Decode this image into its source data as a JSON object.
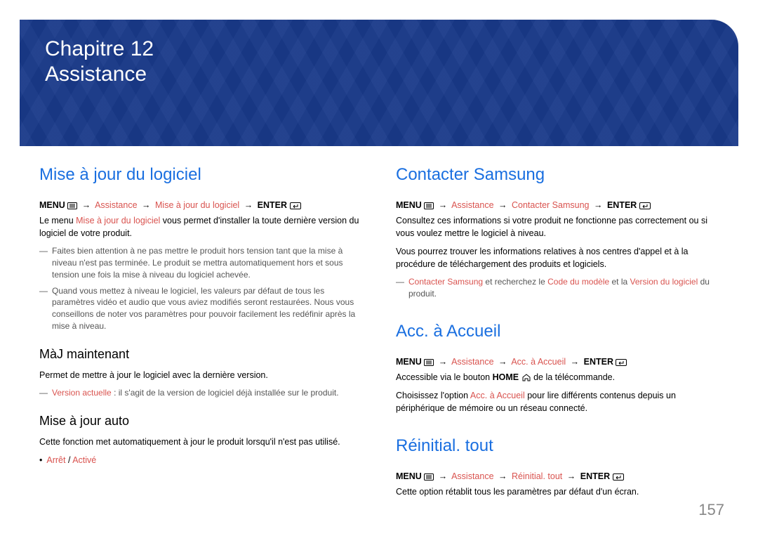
{
  "banner": {
    "line1": "Chapitre 12",
    "line2": "Assistance"
  },
  "pageNumber": "157",
  "menuLabel": "MENU",
  "enterLabel": "ENTER",
  "arrow": "→",
  "nav": {
    "assistance": "Assistance"
  },
  "softwareUpdate": {
    "title": "Mise à jour du logiciel",
    "navItem": "Mise à jour du logiciel",
    "intro_pre": "Le menu ",
    "intro_hl": "Mise à jour du logiciel",
    "intro_post": " vous permet d'installer la toute dernière version du logiciel de votre produit.",
    "note1": "Faites bien attention à ne pas mettre le produit hors tension tant que la mise à niveau n'est pas terminée. Le produit se mettra automatiquement hors et sous tension une fois la mise à niveau du logiciel achevée.",
    "note2": "Quand vous mettez à niveau le logiciel, les valeurs par défaut de tous les paramètres vidéo et audio que vous aviez modifiés seront restaurées. Nous vous conseillons de noter vos paramètres pour pouvoir facilement les redéfinir après la mise à niveau."
  },
  "updateNow": {
    "title": "MàJ maintenant",
    "desc": "Permet de mettre à jour le logiciel avec la dernière version.",
    "note_hl": "Version actuelle",
    "note_post": " : il s'agit de la version de logiciel déjà installée sur le produit."
  },
  "autoUpdate": {
    "title": "Mise à jour auto",
    "desc": "Cette fonction met automatiquement à jour le produit lorsqu'il n'est pas utilisé.",
    "opt1": "Arrêt",
    "optSep": " / ",
    "opt2": "Activé"
  },
  "contact": {
    "title": "Contacter Samsung",
    "navItem": "Contacter Samsung",
    "p1": "Consultez ces informations si votre produit ne fonctionne pas correctement ou si vous voulez mettre le logiciel à niveau.",
    "p2": "Vous pourrez trouver les informations relatives à nos centres d'appel et à la procédure de téléchargement des produits et logiciels.",
    "note_hl1": "Contacter Samsung",
    "note_mid1": " et recherchez le ",
    "note_hl2": "Code du modèle",
    "note_mid2": " et la ",
    "note_hl3": "Version du logiciel",
    "note_post": " du produit."
  },
  "home": {
    "title": "Acc. à Accueil",
    "navItem": "Acc. à Accueil",
    "p1_pre": "Accessible via le bouton ",
    "p1_home": "HOME",
    "p1_post": " de la télécommande.",
    "p2_pre": "Choisissez l'option ",
    "p2_hl": "Acc. à Accueil",
    "p2_post": " pour lire différents contenus depuis un périphérique de mémoire ou un réseau connecté."
  },
  "reset": {
    "title": "Réinitial. tout",
    "navItem": "Réinitial. tout",
    "p1": "Cette option rétablit tous les paramètres par défaut d'un écran."
  }
}
